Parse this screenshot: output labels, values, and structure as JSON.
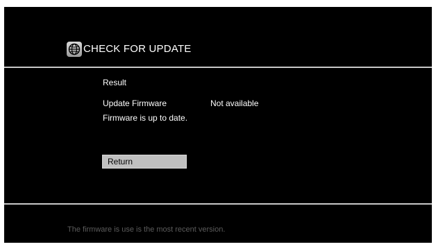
{
  "header": {
    "icon": "globe-icon",
    "title": "CHECK FOR UPDATE"
  },
  "result": {
    "heading": "Result",
    "update_firmware_label": "Update Firmware",
    "update_firmware_value": "Not available",
    "message": "Firmware is up to date."
  },
  "actions": {
    "return_label": "Return"
  },
  "footer": {
    "help_text": "The firmware is use is the most recent version."
  },
  "colors": {
    "background": "#000000",
    "text": "#ffffff",
    "divider": "#c8c8c8",
    "button_bg": "#c0c0c0",
    "footer_text": "#5c5c5c"
  }
}
